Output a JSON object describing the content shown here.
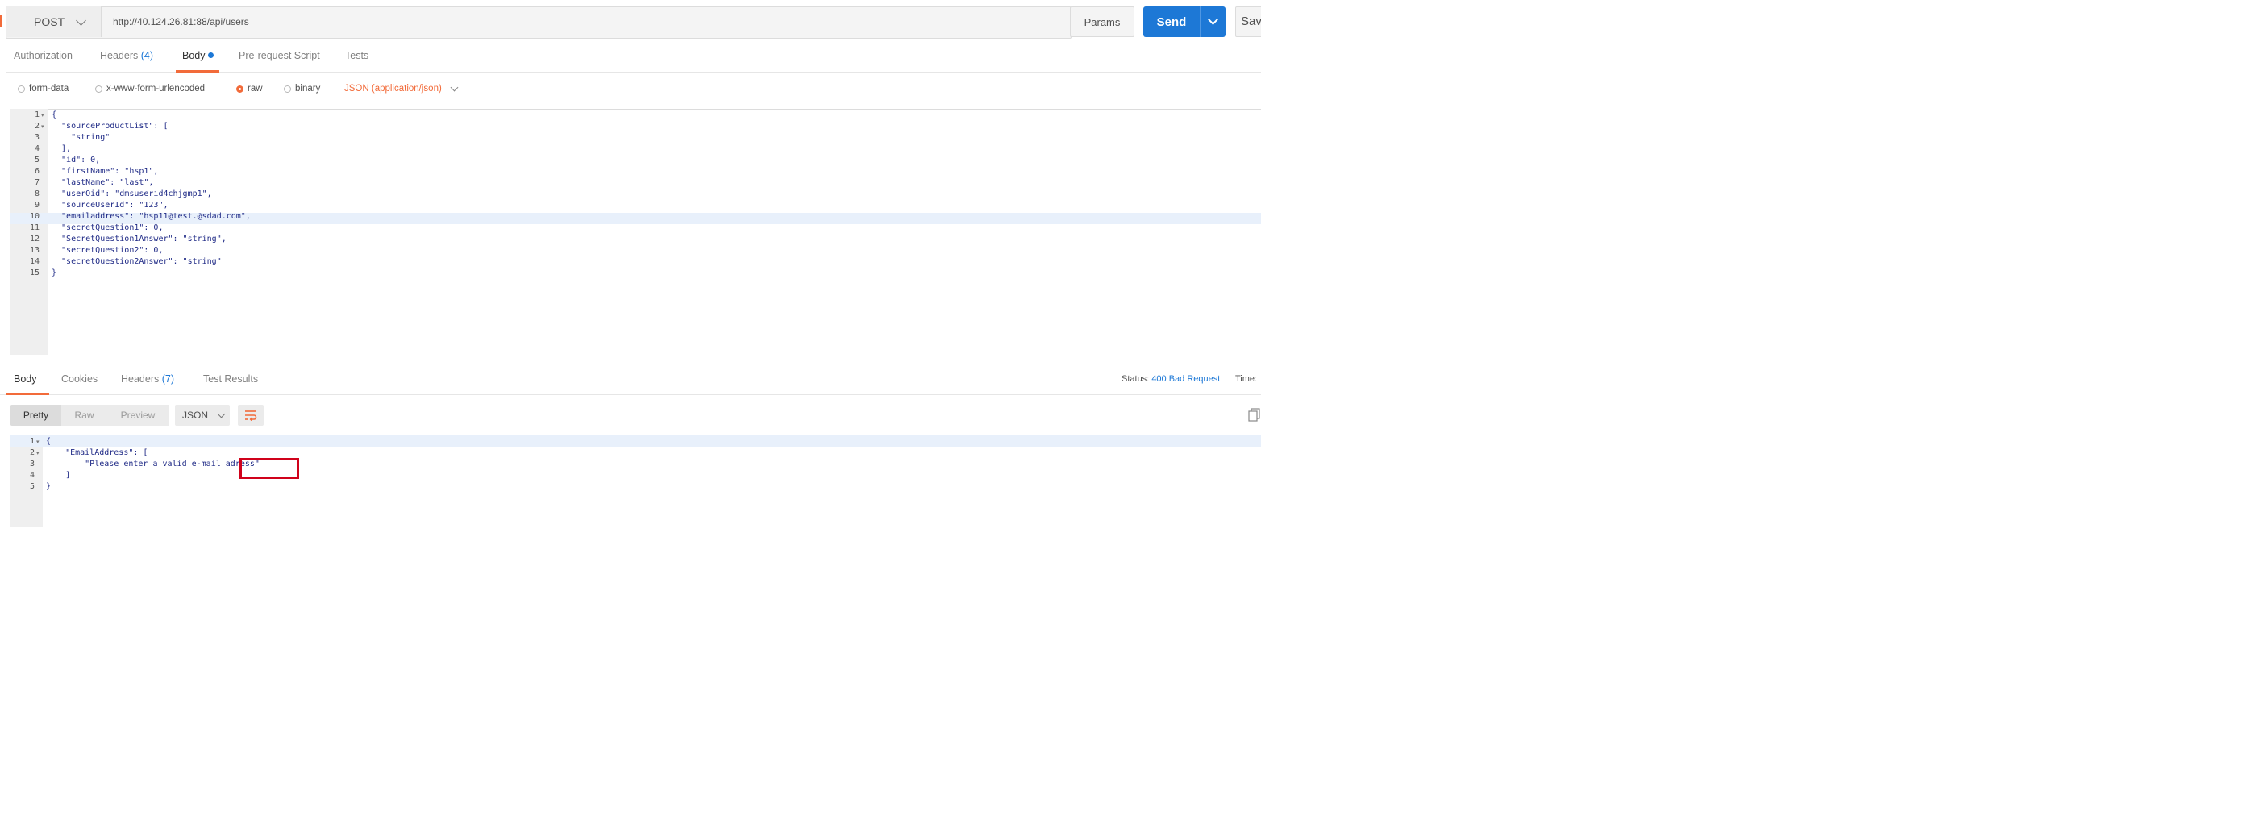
{
  "request": {
    "method": "POST",
    "url": "http://40.124.26.81:88/api/users",
    "params_label": "Params",
    "send_label": "Send",
    "save_label": "Sav"
  },
  "request_tabs": [
    {
      "label": "Authorization",
      "count": ""
    },
    {
      "label": "Headers",
      "count": "(4)"
    },
    {
      "label": "Body",
      "count": ""
    },
    {
      "label": "Pre-request Script",
      "count": ""
    },
    {
      "label": "Tests",
      "count": ""
    }
  ],
  "body_types": [
    "form-data",
    "x-www-form-urlencoded",
    "raw",
    "binary"
  ],
  "body_type_selected": "raw",
  "content_type": "JSON (application/json)",
  "request_body": {
    "line_numbers": [
      "1",
      "2",
      "3",
      "4",
      "5",
      "6",
      "7",
      "8",
      "9",
      "10",
      "11",
      "12",
      "13",
      "14",
      "15"
    ],
    "lines": [
      "{",
      "  \"sourceProductList\": [",
      "    \"string\"",
      "  ],",
      "  \"id\": 0,",
      "  \"firstName\": \"hsp1\",",
      "  \"lastName\": \"last\",",
      "  \"userOid\": \"dmsuserid4chjgmp1\",",
      "  \"sourceUserId\": \"123\",",
      "  \"emailaddress\": \"hsp11@test.@sdad.com\",",
      "  \"secretQuestion1\": 0,",
      "  \"SecretQuestion1Answer\": \"string\",",
      "  \"secretQuestion2\": 0,",
      "  \"secretQuestion2Answer\": \"string\"",
      "}"
    ]
  },
  "response_tabs": [
    {
      "label": "Body",
      "count": ""
    },
    {
      "label": "Cookies",
      "count": ""
    },
    {
      "label": "Headers",
      "count": "(7)"
    },
    {
      "label": "Test Results",
      "count": ""
    }
  ],
  "status": {
    "label": "Status:",
    "value": "400 Bad Request",
    "time_label": "Time:"
  },
  "view_modes": [
    "Pretty",
    "Raw",
    "Preview"
  ],
  "format": "JSON",
  "response_body": {
    "line_numbers": [
      "1",
      "2",
      "3",
      "4",
      "5"
    ],
    "lines": [
      "{",
      "    \"EmailAddress\": [",
      "        \"Please enter a valid e-mail adress\"",
      "    ]",
      "}"
    ]
  },
  "colors": {
    "accent": "#f26b3a",
    "primary": "#1d78d6",
    "annotation": "#d0021b"
  },
  "icons": {
    "method_dropdown": "chevron-down-icon",
    "send_dropdown": "chevron-down-icon",
    "wrap": "word-wrap-icon",
    "copy": "copy-icon"
  }
}
